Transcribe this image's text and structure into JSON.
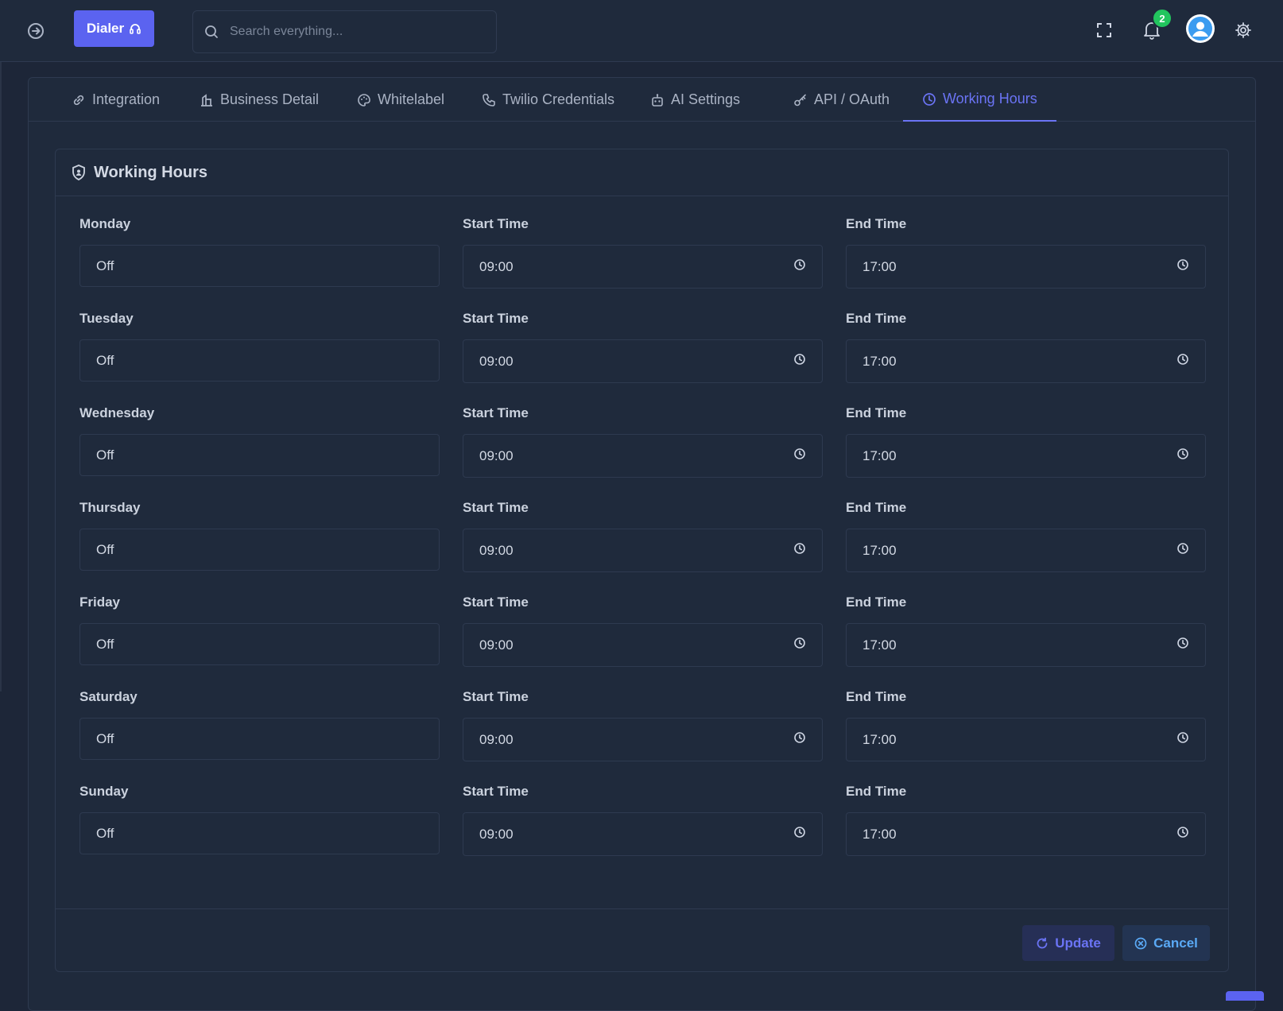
{
  "topbar": {
    "dialer_label": "Dialer",
    "search_placeholder": "Search everything...",
    "notification_count": "2"
  },
  "tabs": [
    {
      "label": "Integration",
      "icon": "link-icon"
    },
    {
      "label": "Business Detail",
      "icon": "building-icon"
    },
    {
      "label": "Whitelabel",
      "icon": "palette-icon"
    },
    {
      "label": "Twilio Credentials",
      "icon": "phone-icon"
    },
    {
      "label": "AI Settings",
      "icon": "robot-icon"
    },
    {
      "label": "API / OAuth",
      "icon": "key-icon"
    },
    {
      "label": "Working Hours",
      "icon": "clock-icon",
      "active": true
    }
  ],
  "panel": {
    "title": "Working Hours",
    "start_label": "Start Time",
    "end_label": "End Time"
  },
  "days": [
    {
      "day": "Monday",
      "status": "Off",
      "start": "09:00",
      "end": "17:00"
    },
    {
      "day": "Tuesday",
      "status": "Off",
      "start": "09:00",
      "end": "17:00"
    },
    {
      "day": "Wednesday",
      "status": "Off",
      "start": "09:00",
      "end": "17:00"
    },
    {
      "day": "Thursday",
      "status": "Off",
      "start": "09:00",
      "end": "17:00"
    },
    {
      "day": "Friday",
      "status": "Off",
      "start": "09:00",
      "end": "17:00"
    },
    {
      "day": "Saturday",
      "status": "Off",
      "start": "09:00",
      "end": "17:00"
    },
    {
      "day": "Sunday",
      "status": "Off",
      "start": "09:00",
      "end": "17:00"
    }
  ],
  "actions": {
    "update_label": "Update",
    "cancel_label": "Cancel"
  },
  "colors": {
    "accent": "#5b63f0",
    "active_tab": "#6b74f5",
    "badge": "#22c55e",
    "cancel": "#5aa9f5"
  }
}
